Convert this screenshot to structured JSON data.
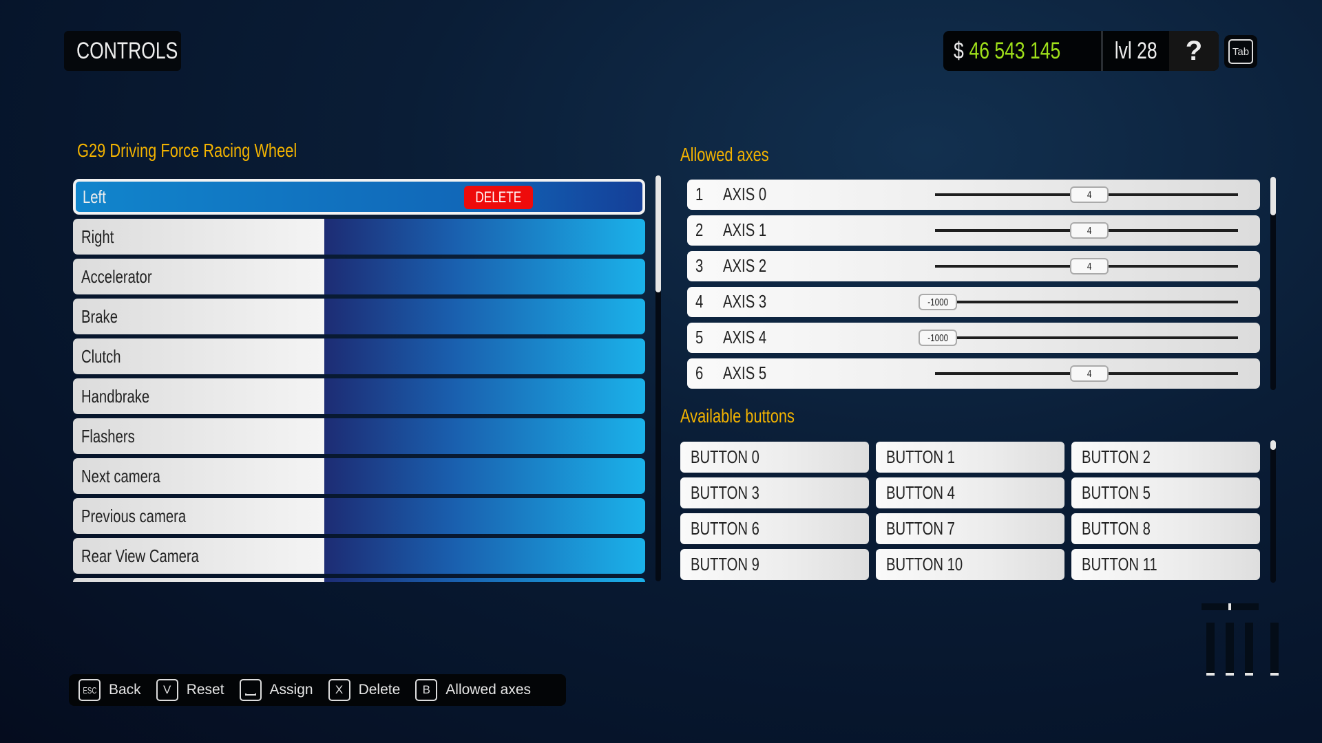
{
  "header": {
    "title": "CONTROLS",
    "currency_symbol": "$",
    "money": "46 543 145",
    "level": "lvl 28",
    "help_icon": "?",
    "tab_key": "Tab"
  },
  "device": {
    "title": "G29 Driving Force Racing Wheel",
    "controls": [
      {
        "label": "Left",
        "selected": true,
        "delete_label": "DELETE"
      },
      {
        "label": "Right"
      },
      {
        "label": "Accelerator"
      },
      {
        "label": "Brake"
      },
      {
        "label": "Clutch"
      },
      {
        "label": "Handbrake"
      },
      {
        "label": "Flashers"
      },
      {
        "label": "Next camera"
      },
      {
        "label": "Previous camera"
      },
      {
        "label": "Rear View Camera"
      },
      {
        "label": ""
      }
    ]
  },
  "axes": {
    "title": "Allowed axes",
    "items": [
      {
        "num": "1",
        "name": "AXIS 0",
        "value": "4"
      },
      {
        "num": "2",
        "name": "AXIS 1",
        "value": "4"
      },
      {
        "num": "3",
        "name": "AXIS 2",
        "value": "4"
      },
      {
        "num": "4",
        "name": "AXIS 3",
        "value": "-1000"
      },
      {
        "num": "5",
        "name": "AXIS 4",
        "value": "-1000"
      },
      {
        "num": "6",
        "name": "AXIS 5",
        "value": "4"
      }
    ]
  },
  "buttons": {
    "title": "Available buttons",
    "items": [
      "BUTTON 0",
      "BUTTON 1",
      "BUTTON 2",
      "BUTTON 3",
      "BUTTON 4",
      "BUTTON 5",
      "BUTTON 6",
      "BUTTON 7",
      "BUTTON 8",
      "BUTTON 9",
      "BUTTON 10",
      "BUTTON 11"
    ]
  },
  "hints": [
    {
      "key": "ESC",
      "label": "Back"
    },
    {
      "key": "V",
      "label": "Reset"
    },
    {
      "key": "",
      "label": "Assign",
      "icon": "spacebar-icon"
    },
    {
      "key": "X",
      "label": "Delete"
    },
    {
      "key": "B",
      "label": "Allowed axes"
    }
  ],
  "colors": {
    "accent_title": "#f3b300",
    "money": "#9fe01a",
    "delete": "#ee0b0b",
    "selected_row": "#1185cc"
  }
}
